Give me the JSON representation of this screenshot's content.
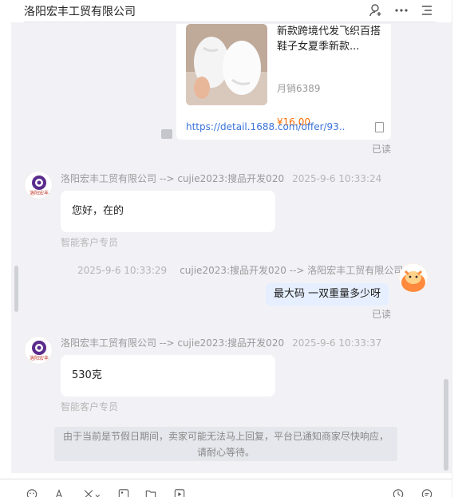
{
  "header": {
    "title": "洛阳宏丰工贸有限公司",
    "icons": [
      "add-contact-icon",
      "more-icon",
      "menu-icon"
    ]
  },
  "product": {
    "title": "新款跨境代发飞织百搭鞋子女夏季新款...",
    "sales": "月销6389",
    "price": "¥16.00",
    "link": "https://detail.1688.com/offer/93..."
  },
  "messages": [
    {
      "direction": "in",
      "sender": "洛阳宏丰工贸有限公司 --> cujie2023:搜品开发020",
      "time": "2025-9-6 10:33:24",
      "text": "您好，在的",
      "tag": "智能客户专员"
    },
    {
      "direction": "out",
      "sender": "cujie2023:搜品开发020 --> 洛阳宏丰工贸有限公司",
      "time": "2025-9-6 10:33:29",
      "text": "最大码 一双重量多少呀",
      "status": "已读"
    },
    {
      "direction": "in",
      "sender": "洛阳宏丰工贸有限公司 --> cujie2023:搜品开发020",
      "time": "2025-9-6 10:33:37",
      "text": "530克",
      "tag": "智能客户专员"
    }
  ],
  "product_status": "已读",
  "avatar_label": "洛阳宏丰",
  "notice": {
    "line1": "由于当前是节假日期间，卖家可能无法马上回复，平台已通知商家尽快响应，",
    "line2": "请耐心等待。"
  },
  "toolbar": {
    "icons": [
      "emoji-icon",
      "font-icon",
      "scissors-icon",
      "image-icon",
      "folder-icon",
      "video-icon",
      "history-icon",
      "quick-reply-icon"
    ]
  },
  "colors": {
    "price": "#ff6a00",
    "link": "#3b73d9",
    "chat_bg": "#f2f2f6",
    "out_bubble": "#e6efff"
  }
}
